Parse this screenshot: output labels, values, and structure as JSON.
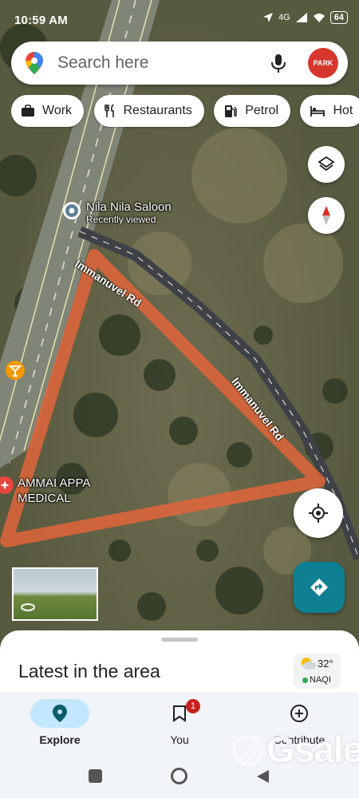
{
  "status": {
    "time": "10:59 AM",
    "network": "4G",
    "battery": "64"
  },
  "search": {
    "placeholder": "Search here",
    "avatar_text": "PARK"
  },
  "chips": [
    {
      "icon": "briefcase-icon",
      "label": "Work"
    },
    {
      "icon": "restaurant-icon",
      "label": "Restaurants"
    },
    {
      "icon": "fuel-icon",
      "label": "Petrol"
    },
    {
      "icon": "hotel-icon",
      "label": "Hot"
    }
  ],
  "map": {
    "place": {
      "name": "Nila Nila Saloon",
      "sub": "Recently viewed"
    },
    "road_label_1": "Immanuvel Rd",
    "road_label_2": "Immanuvel Rd",
    "poi_medical": "AMMAI APPA\nMEDICAL"
  },
  "sheet": {
    "title": "Latest in the area",
    "weather_temp": "32°",
    "weather_aqi": "NAQI"
  },
  "nav": {
    "explore": "Explore",
    "you": "You",
    "you_badge": "1",
    "contribute": "Contribute"
  },
  "watermark": "Gsale",
  "colors": {
    "accent": "#0f7f92",
    "explore_pill": "#c2e7ff",
    "boundary": "#e0653a",
    "badge": "#c5221f"
  }
}
